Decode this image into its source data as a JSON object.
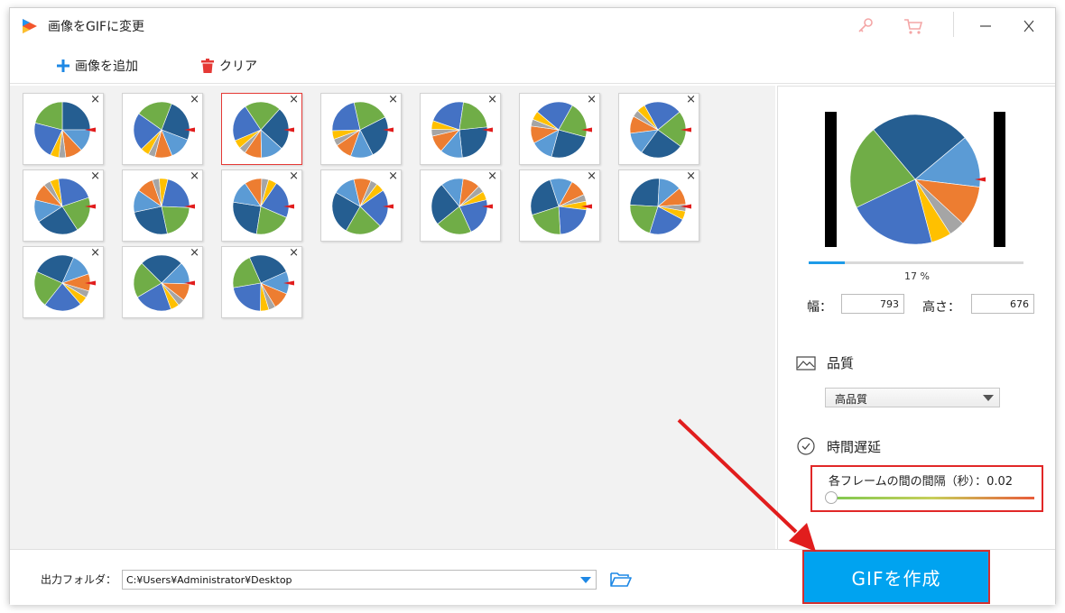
{
  "window": {
    "title": "画像をGIFに変更"
  },
  "toolbar": {
    "add_label": "画像を追加",
    "clear_label": "クリア"
  },
  "thumbnails": {
    "close_glyph": "×",
    "count": 17,
    "selected_index": 2
  },
  "preview": {
    "progress_percent": 17,
    "progress_text": "17 %"
  },
  "dimensions": {
    "width_label": "幅：",
    "width_value": "793",
    "height_label": "高さ：",
    "height_value": "676"
  },
  "quality": {
    "label": "品質",
    "selected": "高品質"
  },
  "delay": {
    "label": "時間遅延",
    "text": "各フレームの間の間隔（秒）：",
    "value": "0.02"
  },
  "output": {
    "label": "出力フォルダ：",
    "path": "C:¥Users¥Administrator¥Desktop"
  },
  "create_button": {
    "label": "GIFを作成"
  },
  "colors": {
    "accent": "#00a3f0",
    "highlight": "#e12727",
    "pie_dark_blue": "#255e91",
    "pie_light_blue": "#5b9bd5",
    "pie_orange": "#ed7d31",
    "pie_gray": "#a5a5a5",
    "pie_yellow": "#ffc000",
    "pie_blue": "#4472c4",
    "pie_green": "#70ad47"
  }
}
